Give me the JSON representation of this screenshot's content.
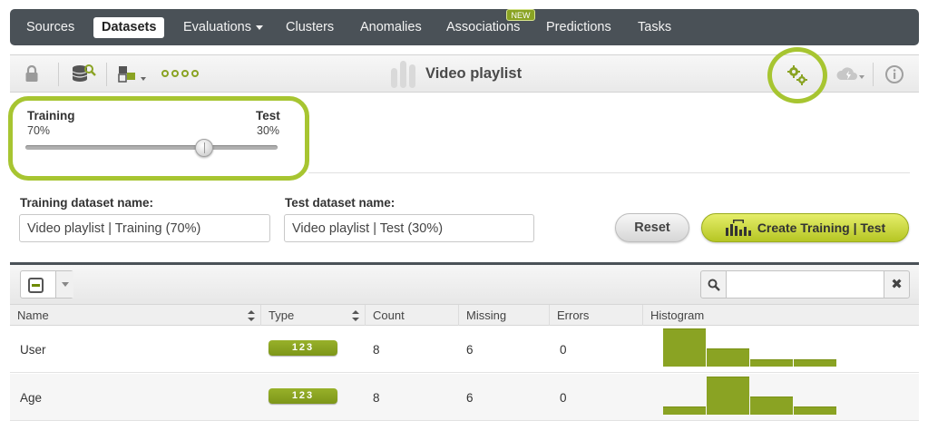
{
  "nav": {
    "items": [
      {
        "label": "Sources"
      },
      {
        "label": "Datasets"
      },
      {
        "label": "Evaluations"
      },
      {
        "label": "Clusters"
      },
      {
        "label": "Anomalies"
      },
      {
        "label": "Associations"
      },
      {
        "label": "Predictions"
      },
      {
        "label": "Tasks"
      }
    ],
    "active": "Datasets",
    "new_badge": "NEW"
  },
  "toolbar": {
    "title": "Video playlist",
    "icons": [
      "lock-icon",
      "dataset-search-icon",
      "field-transform-icon",
      "more-dots-icon",
      "gears-icon",
      "cloud-action-icon",
      "info-icon"
    ]
  },
  "split": {
    "training_label": "Training",
    "test_label": "Test",
    "training_pct": "70%",
    "test_pct": "30%",
    "training_fraction": 0.7
  },
  "form": {
    "training_name_label": "Training dataset name:",
    "test_name_label": "Test dataset name:",
    "training_name_value": "Video playlist | Training (70%)",
    "test_name_value": "Video playlist | Test (30%)",
    "reset_label": "Reset",
    "create_label": "Create Training | Test"
  },
  "table": {
    "search_placeholder": "",
    "clear_label": "✖",
    "columns": [
      "Name",
      "Type",
      "Count",
      "Missing",
      "Errors",
      "Histogram"
    ],
    "rows": [
      {
        "name": "User",
        "type": "123",
        "count": "8",
        "missing": "6",
        "errors": "0",
        "histogram": [
          1.0,
          0.48,
          0.2,
          0.2
        ]
      },
      {
        "name": "Age",
        "type": "123",
        "count": "8",
        "missing": "6",
        "errors": "0",
        "histogram": [
          0.22,
          1.0,
          0.48,
          0.22
        ]
      }
    ]
  },
  "colors": {
    "accent": "#8aa323",
    "highlight": "#a7c531",
    "navbar": "#4a5157"
  }
}
